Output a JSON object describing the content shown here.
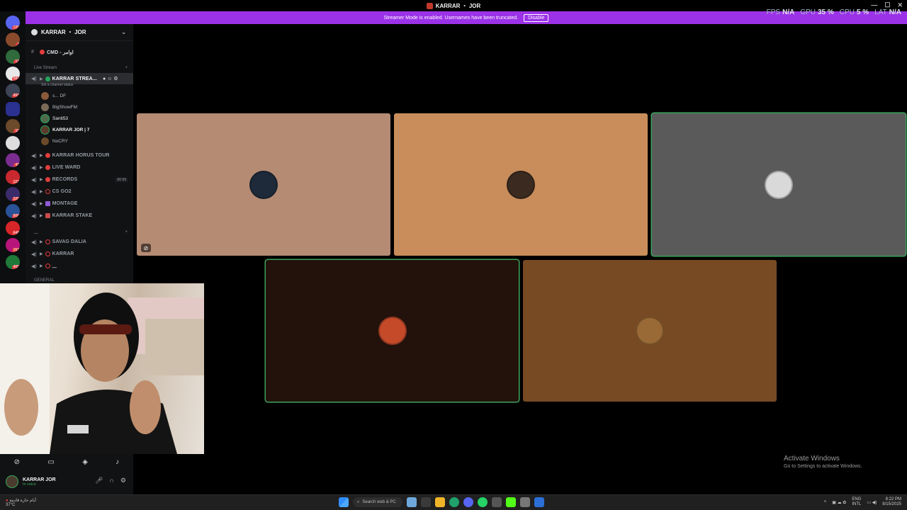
{
  "window": {
    "title": "KARRAR ・ JOR"
  },
  "banner": {
    "text": "Streamer Mode is enabled. Usernames have been truncated.",
    "disable_label": "Disable"
  },
  "hud": [
    {
      "key": "FPS",
      "val": "N/A"
    },
    {
      "key": "GPU",
      "val": "35 %"
    },
    {
      "key": "CPU",
      "val": "5 %"
    },
    {
      "key": "LAT",
      "val": "N/A"
    }
  ],
  "server_badges": [
    "120",
    "2",
    "13",
    "584",
    "493",
    "10",
    "43",
    "122",
    "220",
    "906",
    "648",
    "163",
    "400"
  ],
  "guild": {
    "name": "KARRAR ・ JOR"
  },
  "channels": {
    "cmd": "CMD - اوامر",
    "live_category": "Live Stream",
    "live_channel": "KARRAR STREA...",
    "live_status": "Set a channel status",
    "voice_users": [
      "s... DF",
      "BigShowFM",
      "Santi53",
      "KARRAR JOR | 7",
      "NoCRY"
    ],
    "voice_channels": [
      {
        "name": "KARRAR HORUS TOUR",
        "count": ""
      },
      {
        "name": "LIVE WARD",
        "count": ""
      },
      {
        "name": "RECORDS",
        "count": "00 99"
      },
      {
        "name": "CS GO2",
        "count": ""
      },
      {
        "name": "MONTAGE",
        "count": ""
      },
      {
        "name": "KARRAR STAKE",
        "count": ""
      }
    ],
    "second_category": "ـــ",
    "second_channels": [
      "SAVAG DALIA",
      "KARRAR",
      "ـــ"
    ],
    "general_category": "GENERAL"
  },
  "tiles": [
    {
      "bg": "#b58b74",
      "avatar": "#1e2a3a",
      "speaking": false,
      "muted": true
    },
    {
      "bg": "#c88d5a",
      "avatar": "#3b2a20",
      "speaking": false,
      "muted": false
    },
    {
      "bg": "#5a5a5a",
      "avatar": "#d9d9d9",
      "speaking": true,
      "muted": false
    },
    {
      "bg": "#23120b",
      "avatar": "#c44a2a",
      "speaking": true,
      "muted": false
    },
    {
      "bg": "#774a24",
      "avatar": "#9a6a36",
      "speaking": false,
      "muted": false
    }
  ],
  "user_panel": {
    "name": "KARRAR JOR",
    "status": "In voice"
  },
  "activate": {
    "title": "Activate Windows",
    "sub": "Go to Settings to activate Windows."
  },
  "taskbar": {
    "weather": "أيام حارة قادمة",
    "weather_temp": "37°C",
    "search_placeholder": "Search web & PC",
    "lang": "ENG",
    "lang_sub": "INTL",
    "time": "8:22 PM",
    "date": "8/15/2025"
  }
}
